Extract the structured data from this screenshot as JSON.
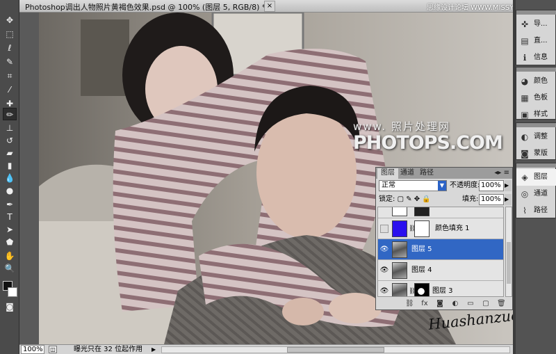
{
  "window": {
    "title": "Photoshop调出人物照片黄褐色效果.psd @ 100% (图层 5, RGB/8) *",
    "close_label": "×",
    "watermark_top": "思缘设计论坛 WWW.MISSYUAN.COM"
  },
  "photo_watermark": {
    "line1": "www.   照片处理网",
    "line2": "PHOTOPS.COM"
  },
  "signature": "Huashanzuo",
  "status": {
    "zoom": "100%",
    "message": "曝光只在 32 位起作用",
    "arrow": "▶"
  },
  "dock": {
    "group1": [
      {
        "icon": "navigator-icon",
        "glyph": "✜",
        "label": "导..."
      },
      {
        "icon": "histogram-icon",
        "glyph": "▤",
        "label": "直..."
      },
      {
        "icon": "info-icon",
        "glyph": "ℹ",
        "label": "信息"
      }
    ],
    "group2": [
      {
        "icon": "color-icon",
        "glyph": "◕",
        "label": "颜色"
      },
      {
        "icon": "swatches-icon",
        "glyph": "▦",
        "label": "色板"
      },
      {
        "icon": "styles-icon",
        "glyph": "▣",
        "label": "样式"
      }
    ],
    "group3": [
      {
        "icon": "adjustments-icon",
        "glyph": "◐",
        "label": "调整"
      },
      {
        "icon": "masks-icon",
        "glyph": "◙",
        "label": "蒙版"
      }
    ],
    "group4": [
      {
        "icon": "layers-icon",
        "glyph": "◈",
        "label": "图层"
      },
      {
        "icon": "channels-icon",
        "glyph": "◎",
        "label": "通道"
      },
      {
        "icon": "paths-icon",
        "glyph": "⌇",
        "label": "路径"
      }
    ]
  },
  "layers_panel": {
    "tabs": [
      "图层",
      "通道",
      "路径"
    ],
    "panel_controls": "◂▸ ≡",
    "blend_mode": "正常",
    "opacity_label": "不透明度:",
    "opacity": "100%",
    "lock_label": "锁定:",
    "lock_icons": "▢ ✎ ✥ 🔒",
    "fill_label": "填充:",
    "fill": "100%",
    "layers": [
      {
        "name": "",
        "partial": true
      },
      {
        "name": "颜色填充 1",
        "fill_color": "#2a10ee"
      },
      {
        "name": "图层 5",
        "selected": true
      },
      {
        "name": "图层 4"
      },
      {
        "name": "图层 3",
        "has_mask": true
      }
    ],
    "bottom_icons": [
      "⛓",
      "fx",
      "◙",
      "◐",
      "▭",
      "▢",
      "🗑"
    ]
  },
  "colors": {
    "selection": "#3167c4",
    "fill_layer": "#2a10ee"
  }
}
